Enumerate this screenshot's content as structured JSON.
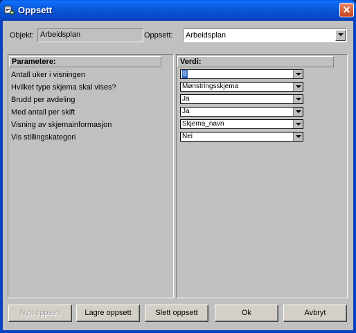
{
  "window": {
    "title": "Oppsett",
    "close_label": "✕"
  },
  "header": {
    "objekt_label": "Objekt:",
    "objekt_value": "Arbeidsplan",
    "oppsett_label": "Oppsett:",
    "oppsett_value": "Arbeidsplan"
  },
  "params_panel": {
    "header": "Parametere:"
  },
  "values_panel": {
    "header": "Verdi:"
  },
  "rows": [
    {
      "label": "Antall uker i visningen",
      "value": "8"
    },
    {
      "label": "Hvilket type skjema skal vises?",
      "value": "Mønstringsskjema"
    },
    {
      "label": "Brudd per avdeling",
      "value": "Ja"
    },
    {
      "label": "Med antall per skift",
      "value": "Ja"
    },
    {
      "label": "Visning av skjemainformasjon",
      "value": "Skjema_navn"
    },
    {
      "label": "Vis stillingskategori",
      "value": "Nei"
    }
  ],
  "buttons": {
    "new": "Nytt oppsett",
    "save": "Lagre oppsett",
    "delete": "Slett oppsett",
    "ok": "Ok",
    "cancel": "Avbryt"
  },
  "colors": {
    "titlebar": "#0a5ad8",
    "client": "#c0c0c0",
    "selection": "#316ac5"
  }
}
